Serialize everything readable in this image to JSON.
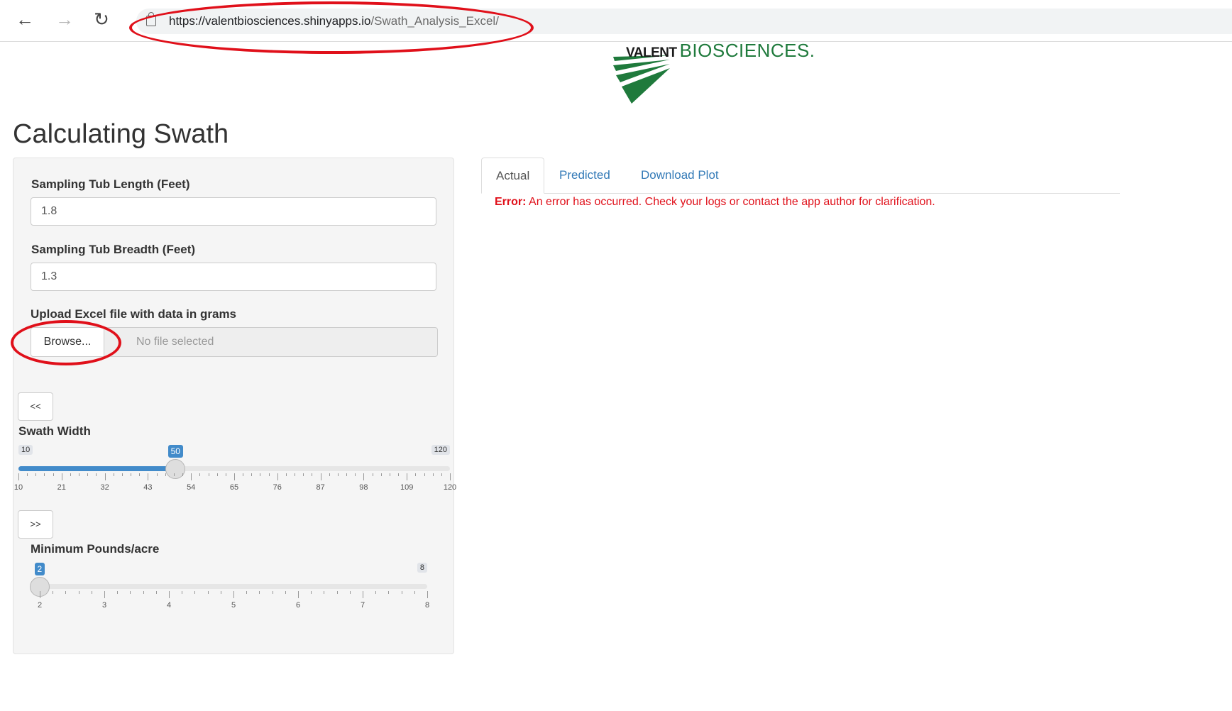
{
  "browser": {
    "url_host": "https://valentbiosciences.shinyapps.io",
    "url_path": "/Swath_Analysis_Excel/"
  },
  "logo": {
    "brand_bold": "VALENT",
    "brand_rest": "BIOSCIENCES."
  },
  "page": {
    "title": "Calculating Swath"
  },
  "sidebar": {
    "tub_length": {
      "label": "Sampling Tub Length (Feet)",
      "value": "1.8"
    },
    "tub_breadth": {
      "label": "Sampling Tub Breadth (Feet)",
      "value": "1.3"
    },
    "upload": {
      "label": "Upload Excel file with data in grams",
      "button": "Browse...",
      "status": "No file selected"
    },
    "prev_button": "<<",
    "next_button": ">>",
    "swath_slider": {
      "label": "Swath Width",
      "min": 10,
      "max": 120,
      "value": 50,
      "min_label": "10",
      "max_label": "120",
      "value_label": "50",
      "ticks": [
        "10",
        "21",
        "32",
        "43",
        "54",
        "65",
        "76",
        "87",
        "98",
        "109",
        "120"
      ]
    },
    "pounds_slider": {
      "label": "Minimum Pounds/acre",
      "min": 2,
      "max": 8,
      "value": 2,
      "max_label": "8",
      "value_label": "2",
      "ticks": [
        "2",
        "3",
        "4",
        "5",
        "6",
        "7",
        "8"
      ]
    }
  },
  "main": {
    "tabs": [
      "Actual",
      "Predicted",
      "Download Plot"
    ],
    "active_tab": "Actual",
    "error_prefix": "Error:",
    "error_text": " An error has occurred. Check your logs or contact the app author for clarification."
  },
  "colors": {
    "accent": "#428bca",
    "error": "#e0101a",
    "annotation": "#e0101a",
    "brand_green": "#1f7a3c"
  },
  "icons": [
    "back-arrow-icon",
    "forward-arrow-icon",
    "reload-icon",
    "lock-icon"
  ]
}
